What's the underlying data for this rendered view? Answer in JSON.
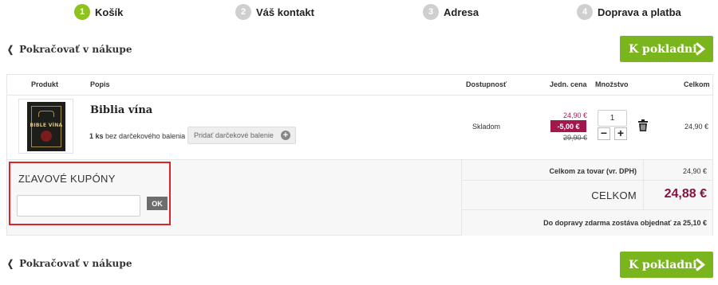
{
  "steps": [
    {
      "num": "1",
      "label": "Košík"
    },
    {
      "num": "2",
      "label": "Váš kontakt"
    },
    {
      "num": "3",
      "label": "Adresa"
    },
    {
      "num": "4",
      "label": "Doprava a platba"
    }
  ],
  "nav": {
    "continue_label": "Pokračovať v nákupe",
    "checkout_label": "K pokladni"
  },
  "table": {
    "headers": {
      "product": "Produkt",
      "description": "Popis",
      "availability": "Dostupnosť",
      "unit_price": "Jedn. cena",
      "quantity": "Množstvo",
      "total": "Celkom"
    }
  },
  "item": {
    "cover_title": "BIBLE VÍNA",
    "title": "Biblia vína",
    "pieces_count": "1 ks",
    "pieces_suffix": "bez darčekového balenia",
    "gift_button": "Pridať darčekové balenie",
    "availability": "Skladom",
    "price": "24,90 €",
    "discount": "-5,00 €",
    "price_original": "29,90 €",
    "quantity": "1",
    "total": "24,90 €"
  },
  "coupon": {
    "title": "ZĽAVOVÉ KUPÓNY",
    "input_value": "",
    "ok_label": "OK"
  },
  "summary": {
    "goods_label": "Celkom za tovar (vr. DPH)",
    "goods_value": "24,90 €",
    "total_label": "CELKOM",
    "total_value": "24,88 €",
    "free_shipping": "Do dopravy zdarma zostáva objednať za 25,10 €"
  },
  "colors": {
    "accent_green": "#7ab51d",
    "step_active": "#8dc21f",
    "discount_bg": "#a1174e",
    "total_price": "#8a1043",
    "highlight_border": "#d9252a"
  }
}
